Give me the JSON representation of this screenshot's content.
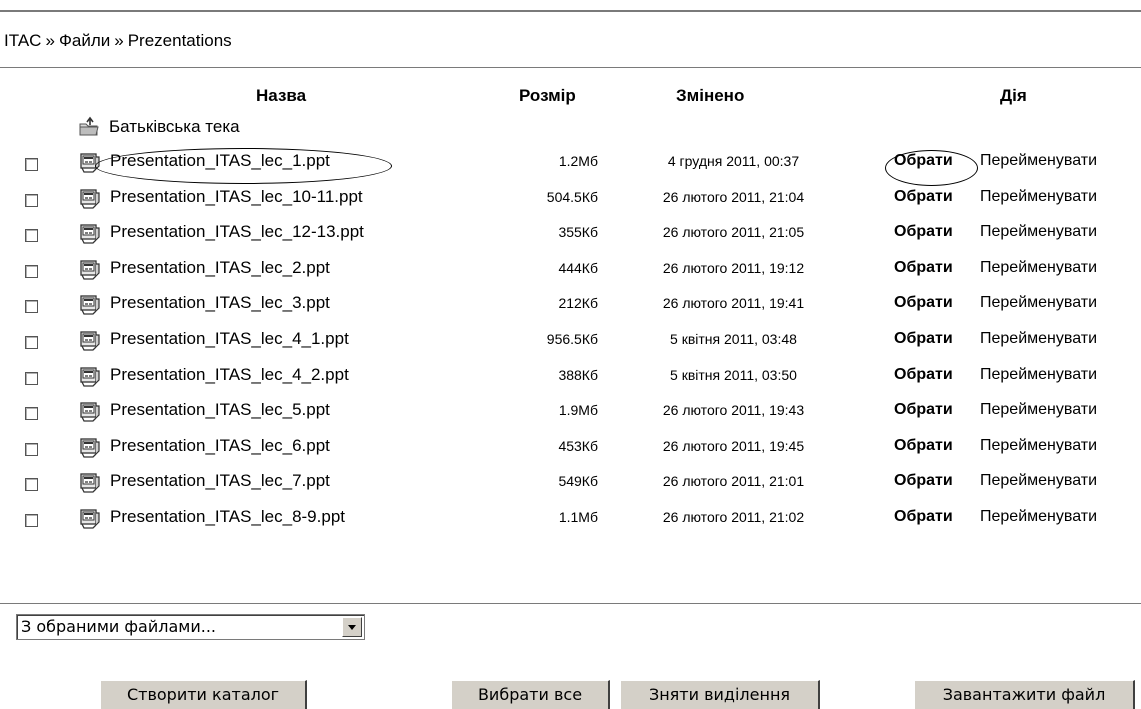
{
  "breadcrumb": {
    "items": [
      "ITAC",
      "Файли"
    ],
    "separator": "»",
    "current": "Prezentations"
  },
  "table": {
    "headers": {
      "name": "Назва",
      "size": "Розмір",
      "modified": "Змінено",
      "action": "Дія"
    },
    "parent_folder": {
      "icon": "parent-folder-icon",
      "label": "Батьківська тека"
    },
    "rows": [
      {
        "name": "Presentation_ITAS_lec_1.ppt",
        "size": "1.2Мб",
        "modified": "4 грудня 2011, 00:37",
        "choose": "Обрати",
        "rename": "Перейменувати"
      },
      {
        "name": "Presentation_ITAS_lec_10-11.ppt",
        "size": "504.5Кб",
        "modified": "26 лютого 2011, 21:04",
        "choose": "Обрати",
        "rename": "Перейменувати"
      },
      {
        "name": "Presentation_ITAS_lec_12-13.ppt",
        "size": "355Кб",
        "modified": "26 лютого 2011, 21:05",
        "choose": "Обрати",
        "rename": "Перейменувати"
      },
      {
        "name": "Presentation_ITAS_lec_2.ppt",
        "size": "444Кб",
        "modified": "26 лютого 2011, 19:12",
        "choose": "Обрати",
        "rename": "Перейменувати"
      },
      {
        "name": "Presentation_ITAS_lec_3.ppt",
        "size": "212Кб",
        "modified": "26 лютого 2011, 19:41",
        "choose": "Обрати",
        "rename": "Перейменувати"
      },
      {
        "name": "Presentation_ITAS_lec_4_1.ppt",
        "size": "956.5Кб",
        "modified": "5 квітня 2011, 03:48",
        "choose": "Обрати",
        "rename": "Перейменувати"
      },
      {
        "name": "Presentation_ITAS_lec_4_2.ppt",
        "size": "388Кб",
        "modified": "5 квітня 2011, 03:50",
        "choose": "Обрати",
        "rename": "Перейменувати"
      },
      {
        "name": "Presentation_ITAS_lec_5.ppt",
        "size": "1.9Мб",
        "modified": "26 лютого 2011, 19:43",
        "choose": "Обрати",
        "rename": "Перейменувати"
      },
      {
        "name": "Presentation_ITAS_lec_6.ppt",
        "size": "453Кб",
        "modified": "26 лютого 2011, 19:45",
        "choose": "Обрати",
        "rename": "Перейменувати"
      },
      {
        "name": "Presentation_ITAS_lec_7.ppt",
        "size": "549Кб",
        "modified": "26 лютого 2011, 21:01",
        "choose": "Обрати",
        "rename": "Перейменувати"
      },
      {
        "name": "Presentation_ITAS_lec_8-9.ppt",
        "size": "1.1Мб",
        "modified": "26 лютого 2011, 21:02",
        "choose": "Обрати",
        "rename": "Перейменувати"
      }
    ],
    "file_icon": "powerpoint-file-icon"
  },
  "footer": {
    "selection_select_value": "З обраними файлами...",
    "create_folder_button": "Створити каталог",
    "select_all_button": "Вибрати все",
    "deselect_button": "Зняти виділення",
    "upload_button": "Завантажити файл"
  },
  "colors": {
    "rule": "#7a7a7a",
    "button_face": "#d4d0c8",
    "background": "#ffffff",
    "text": "#000000"
  }
}
